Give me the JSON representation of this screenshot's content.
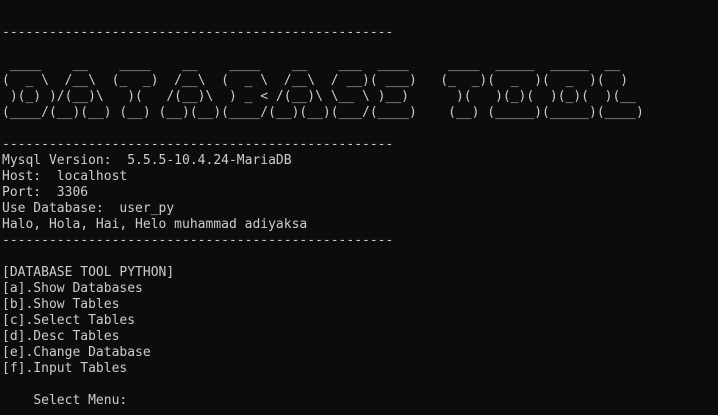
{
  "console": {
    "divider_1": "--------------------------------------------------",
    "banner": [
      " ____    __    ____    __    ____    __    ___  ____     ____  _____  _____  __   ",
      "(  _ \\  /__\\  (_  _)  /__\\  (  _ \\  /__\\  / __)( ___)   (_  _)(  _  )(  _  )(  )  ",
      " )(_) )/(__)\\   )(   /(__)\\  ) _ < /(__)\\ \\__ \\ )__)      )(   )(_)(  )(_)(  )(__ ",
      "(____/(__)(__) (__) (__)(__)(____/(__)(__)(___/(____)    (__) (_____)(_____)(____)"
    ],
    "divider_2": "--------------------------------------------------",
    "info": [
      "Mysql Version:  5.5.5-10.4.24-MariaDB",
      "Host:  localhost",
      "Port:  3306",
      "Use Database:  user_py",
      "Halo, Hola, Hai, Helo muhammad adiyaksa"
    ],
    "divider_3": "--------------------------------------------------",
    "menu_title": "[DATABASE TOOL PYTHON]",
    "menu_items": [
      "[a].Show Databases",
      "[b].Show Tables",
      "[c].Select Tables",
      "[d].Desc Tables",
      "[e].Change Database",
      "[f].Input Tables"
    ],
    "prompt": "Select Menu: "
  }
}
